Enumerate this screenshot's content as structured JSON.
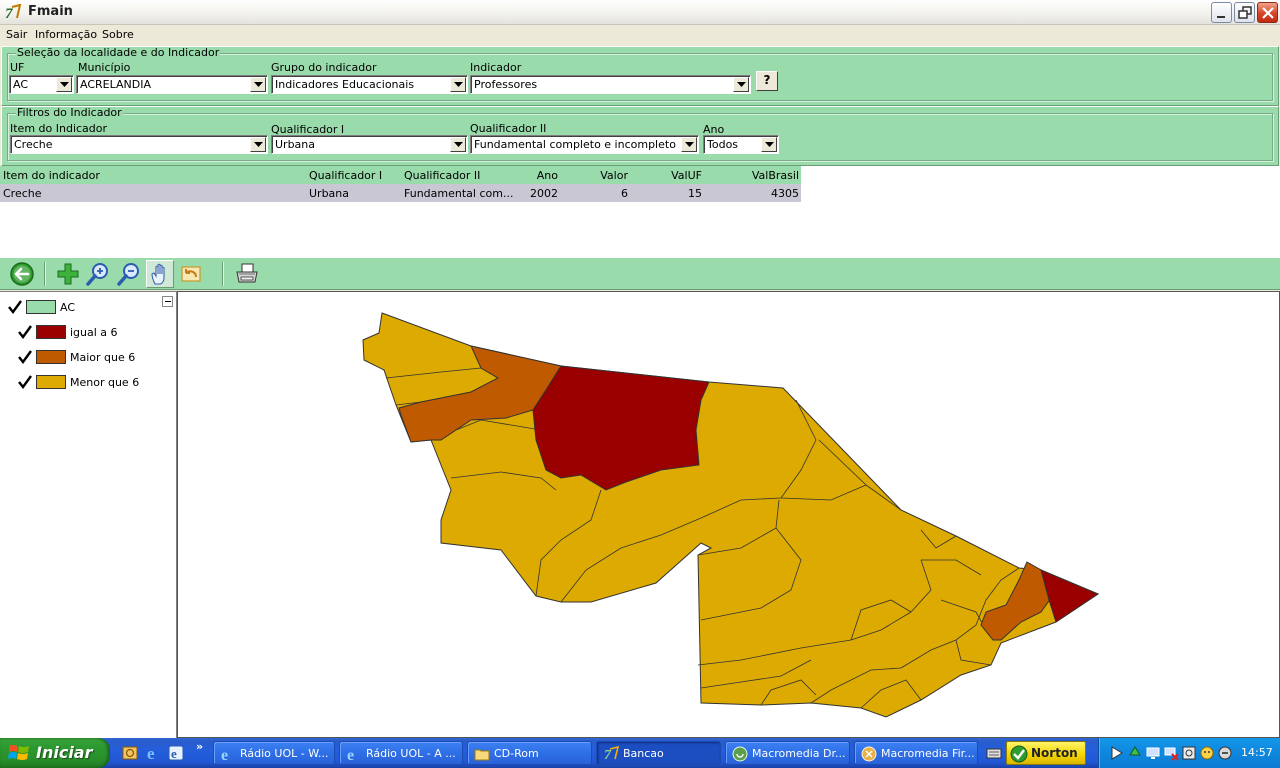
{
  "window": {
    "title": "Fmain"
  },
  "menu": [
    "Sair",
    "Informação",
    "Sobre"
  ],
  "selection_panel": {
    "title": "Seleção da localidade e do Indicador",
    "uf": {
      "label": "UF",
      "value": "AC"
    },
    "municipio": {
      "label": "Município",
      "value": "ACRELANDIA"
    },
    "grupo": {
      "label": "Grupo do indicador",
      "value": "Indicadores Educacionais"
    },
    "indicador": {
      "label": "Indicador",
      "value": "Professores"
    },
    "help_label": "?"
  },
  "filters_panel": {
    "title": "Filtros do Indicador",
    "item": {
      "label": "Item do Indicador",
      "value": "Creche"
    },
    "qual1": {
      "label": "Qualificador I",
      "value": "Urbana"
    },
    "qual2": {
      "label": "Qualificador II",
      "value": "Fundamental completo e incompleto"
    },
    "ano": {
      "label": "Ano",
      "value": "Todos"
    }
  },
  "grid": {
    "columns": [
      "Item do indicador",
      "Qualificador I",
      "Qualificador II",
      "Ano",
      "Valor",
      "ValUF",
      "ValBrasil"
    ],
    "rows": [
      [
        "Creche",
        "Urbana",
        "Fundamental com...",
        "2002",
        "6",
        "15",
        "4305"
      ]
    ]
  },
  "toolbar": {
    "tools": [
      "back-icon",
      "add-layer-icon",
      "zoom-in-icon",
      "zoom-out-icon",
      "pan-hand-icon",
      "undo-zoom-icon",
      "print-icon"
    ]
  },
  "legend": {
    "layer": {
      "label": "AC",
      "color": "#99dbab"
    },
    "classes": [
      {
        "label": "igual a 6",
        "color": "#9a0000"
      },
      {
        "label": "Maior que 6",
        "color": "#c05a00"
      },
      {
        "label": "Menor que 6",
        "color": "#dcaa00"
      }
    ]
  },
  "map": {
    "colors": {
      "equal": "#9a0000",
      "greater": "#c05a00",
      "less": "#dcaa00",
      "border": "#333333"
    }
  },
  "taskbar": {
    "start_label": "Iniciar",
    "tasks": [
      {
        "label": "Rádio UOL - W...",
        "icon": "ie-icon"
      },
      {
        "label": "Rádio UOL - A ...",
        "icon": "ie-icon"
      },
      {
        "label": "CD-Rom",
        "icon": "folder-icon"
      },
      {
        "label": "Bancao",
        "icon": "app-icon"
      },
      {
        "label": "Macromedia Dr...",
        "icon": "dreamweaver-icon"
      },
      {
        "label": "Macromedia Fir...",
        "icon": "fireworks-icon"
      }
    ],
    "norton_label": "Norton",
    "clock": "14:57"
  }
}
